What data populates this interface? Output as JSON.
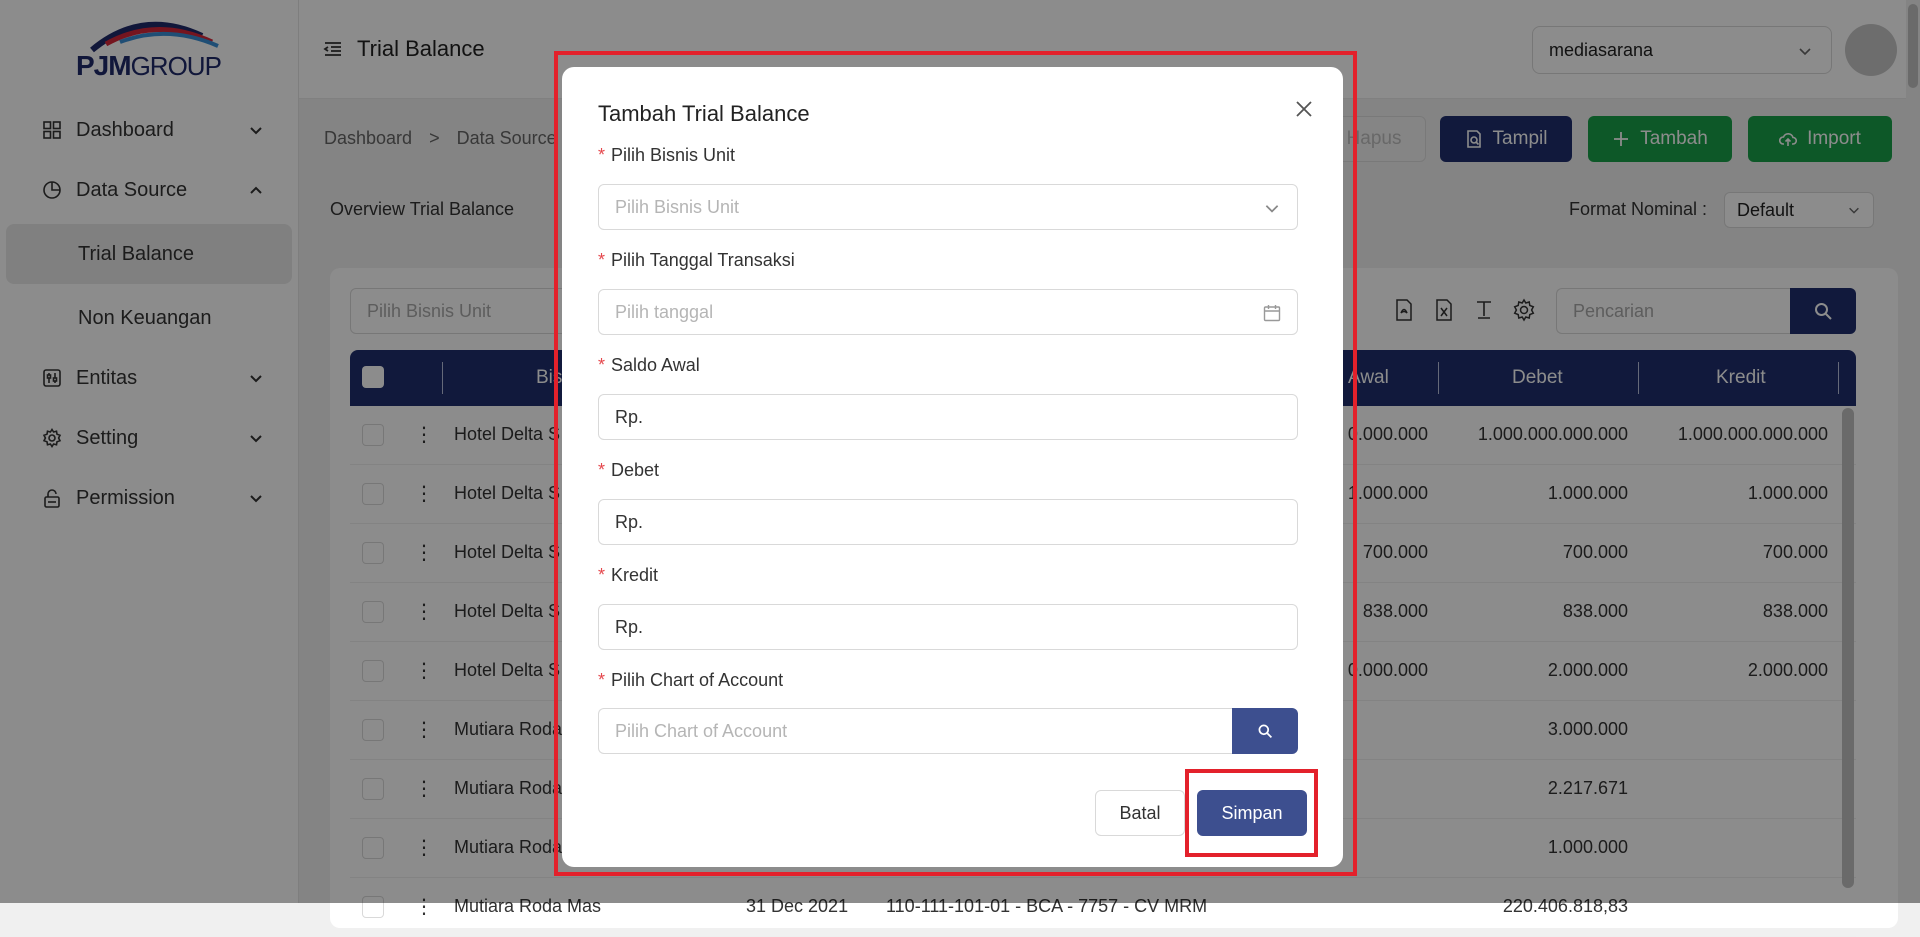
{
  "brand": {
    "logo_main": "PJM",
    "logo_sub": "GROUP"
  },
  "sidebar": {
    "items": [
      {
        "label": "Dashboard",
        "icon": "grid-icon"
      },
      {
        "label": "Data Source",
        "icon": "pie-chart-icon",
        "children": [
          "Trial Balance",
          "Non Keuangan"
        ],
        "active_child": "Trial Balance"
      },
      {
        "label": "Entitas",
        "icon": "sliders-icon"
      },
      {
        "label": "Setting",
        "icon": "gear-icon"
      },
      {
        "label": "Permission",
        "icon": "lock-icon"
      }
    ]
  },
  "header": {
    "title": "Trial Balance",
    "org_select": "mediasarana"
  },
  "breadcrumb": {
    "items": [
      "Dashboard",
      ">",
      "Data Source"
    ]
  },
  "toolbar": {
    "hapus": "Hapus",
    "tampil": "Tampil",
    "tambah": "Tambah",
    "import": "Import"
  },
  "overview": {
    "title": "Overview Trial Balance",
    "format_label": "Format Nominal :",
    "format_value": "Default"
  },
  "filters": {
    "bisnis_unit_placeholder": "Pilih Bisnis Unit",
    "search_placeholder": "Pencarian"
  },
  "table": {
    "columns": [
      "Bis",
      "Awal",
      "Debet",
      "Kredit"
    ],
    "rows": [
      {
        "bu": "Hotel Delta S",
        "tgl": "",
        "acc": "",
        "awal": "0.000.000",
        "debet": "1.000.000.000.000",
        "kredit": "1.000.000.000.000"
      },
      {
        "bu": "Hotel Delta S",
        "tgl": "",
        "acc": "",
        "awal": "1.000.000",
        "debet": "1.000.000",
        "kredit": "1.000.000"
      },
      {
        "bu": "Hotel Delta S",
        "tgl": "",
        "acc": "",
        "awal": "700.000",
        "debet": "700.000",
        "kredit": "700.000"
      },
      {
        "bu": "Hotel Delta S",
        "tgl": "",
        "acc": "",
        "awal": "838.000",
        "debet": "838.000",
        "kredit": "838.000"
      },
      {
        "bu": "Hotel Delta S",
        "tgl": "",
        "acc": "",
        "awal": "0.000.000",
        "debet": "2.000.000",
        "kredit": "2.000.000"
      },
      {
        "bu": "Mutiara Roda",
        "tgl": "",
        "acc": "",
        "awal": "",
        "debet": "3.000.000",
        "kredit": ""
      },
      {
        "bu": "Mutiara Roda",
        "tgl": "",
        "acc": "",
        "awal": "",
        "debet": "2.217.671",
        "kredit": ""
      },
      {
        "bu": "Mutiara Roda",
        "tgl": "",
        "acc": "",
        "awal": "",
        "debet": "1.000.000",
        "kredit": ""
      },
      {
        "bu": "Mutiara Roda Mas",
        "tgl": "31 Dec 2021",
        "acc": "110-111-101-01 - BCA - 7757 - CV MRM",
        "awal": "",
        "debet": "220.406.818,83",
        "kredit": ""
      }
    ]
  },
  "modal": {
    "title": "Tambah Trial Balance",
    "fields": {
      "bisnis_unit": {
        "label": "Pilih Bisnis Unit",
        "placeholder": "Pilih Bisnis Unit"
      },
      "tanggal": {
        "label": "Pilih Tanggal Transaksi",
        "placeholder": "Pilih tanggal"
      },
      "saldo_awal": {
        "label": "Saldo Awal",
        "value": "Rp."
      },
      "debet": {
        "label": "Debet",
        "value": "Rp."
      },
      "kredit": {
        "label": "Kredit",
        "value": "Rp."
      },
      "coa": {
        "label": "Pilih Chart of Account",
        "placeholder": "Pilih Chart of Account"
      }
    },
    "required_mark": "*",
    "batal": "Batal",
    "simpan": "Simpan"
  },
  "colors": {
    "primary": "#1f2f6e",
    "success": "#19a14a",
    "modal_primary": "#3d4f8f",
    "highlight": "#e3212b"
  }
}
